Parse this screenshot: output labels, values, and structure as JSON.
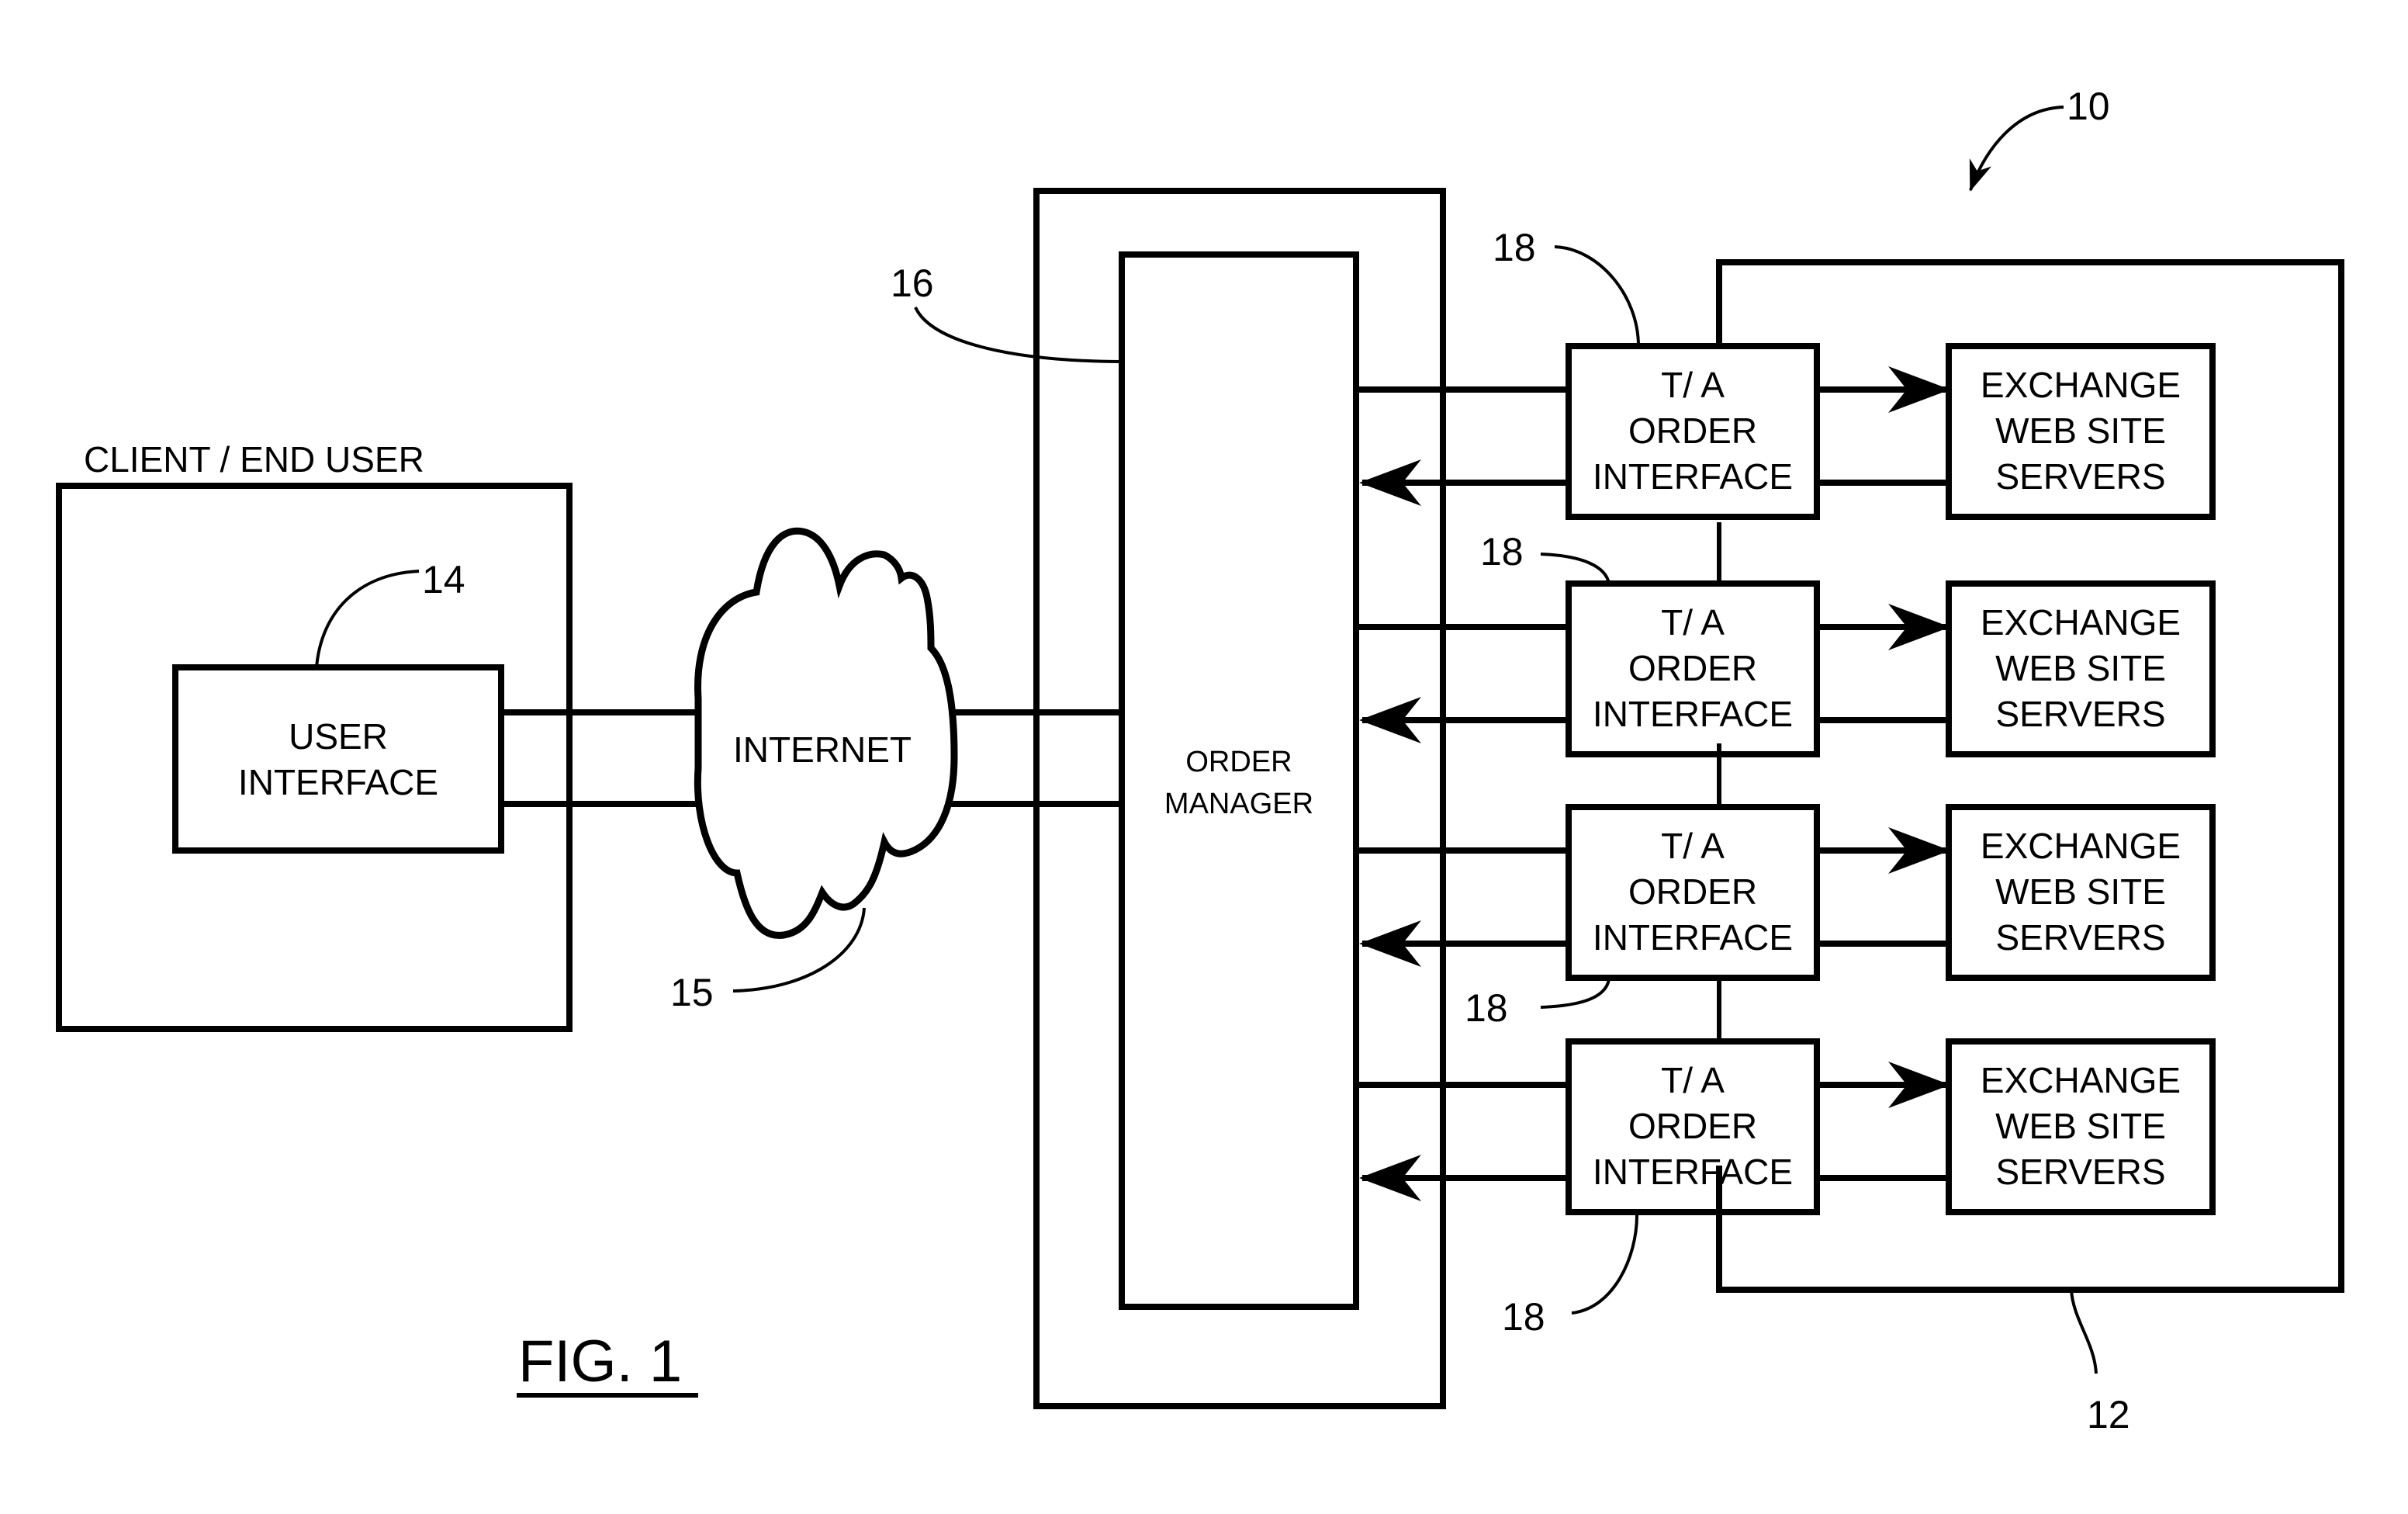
{
  "figure": {
    "caption": "FIG. 1",
    "system_ref": "10"
  },
  "client": {
    "title": "CLIENT / END USER",
    "user_interface": {
      "lines": [
        "USER",
        "INTERFACE"
      ],
      "ref": "14"
    }
  },
  "internet": {
    "label": "INTERNET",
    "ref": "15"
  },
  "order_manager": {
    "lines": [
      "ORDER",
      "MANAGER"
    ],
    "ref": "16"
  },
  "exchange_group": {
    "ref": "12"
  },
  "rows": [
    {
      "interface_lines": [
        "T/ A",
        "ORDER",
        "INTERFACE"
      ],
      "interface_ref": "18",
      "server_lines": [
        "EXCHANGE",
        "WEB SITE",
        "SERVERS"
      ]
    },
    {
      "interface_lines": [
        "T/ A",
        "ORDER",
        "INTERFACE"
      ],
      "interface_ref": "18",
      "server_lines": [
        "EXCHANGE",
        "WEB SITE",
        "SERVERS"
      ]
    },
    {
      "interface_lines": [
        "T/ A",
        "ORDER",
        "INTERFACE"
      ],
      "interface_ref": "18",
      "server_lines": [
        "EXCHANGE",
        "WEB SITE",
        "SERVERS"
      ]
    },
    {
      "interface_lines": [
        "T/ A",
        "ORDER",
        "INTERFACE"
      ],
      "interface_ref": "18",
      "server_lines": [
        "EXCHANGE",
        "WEB SITE",
        "SERVERS"
      ]
    }
  ]
}
